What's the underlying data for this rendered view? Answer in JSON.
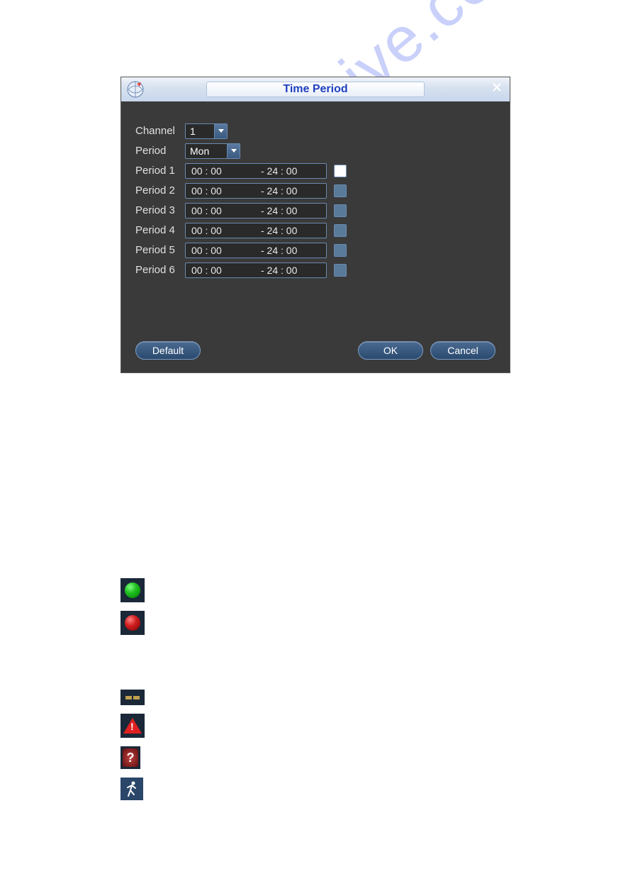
{
  "dialog": {
    "title": "Time Period",
    "channel_label": "Channel",
    "channel_value": "1",
    "period_label": "Period",
    "period_value": "Mon",
    "periods": [
      {
        "label": "Period 1",
        "start": "00 : 00",
        "end": "- 24 : 00",
        "checked": true
      },
      {
        "label": "Period 2",
        "start": "00 : 00",
        "end": "- 24 : 00",
        "checked": false
      },
      {
        "label": "Period 3",
        "start": "00 : 00",
        "end": "- 24 : 00",
        "checked": false
      },
      {
        "label": "Period 4",
        "start": "00 : 00",
        "end": "- 24 : 00",
        "checked": false
      },
      {
        "label": "Period 5",
        "start": "00 : 00",
        "end": "- 24 : 00",
        "checked": false
      },
      {
        "label": "Period 6",
        "start": "00 : 00",
        "end": "- 24 : 00",
        "checked": false
      }
    ],
    "buttons": {
      "default": "Default",
      "ok": "OK",
      "cancel": "Cancel"
    }
  },
  "watermark": "manualshive.com"
}
